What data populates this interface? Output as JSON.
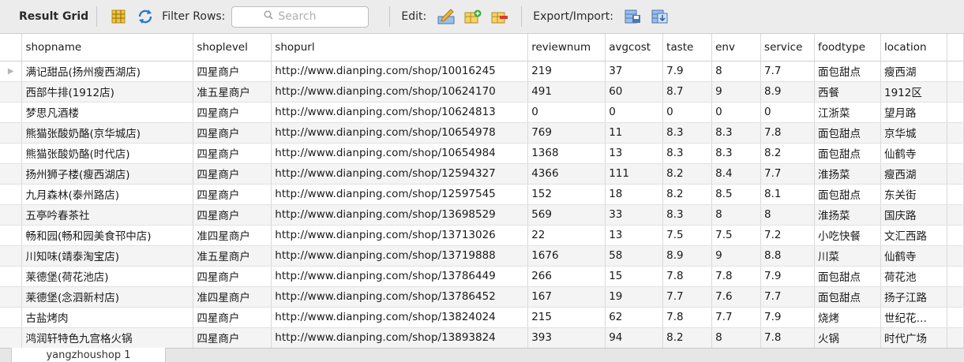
{
  "toolbar": {
    "result_grid_label": "Result Grid",
    "filter_rows_label": "Filter Rows:",
    "search_placeholder": "Search",
    "edit_label": "Edit:",
    "export_import_label": "Export/Import:"
  },
  "columns": [
    "shopname",
    "shoplevel",
    "shopurl",
    "reviewnum",
    "avgcost",
    "taste",
    "env",
    "service",
    "foodtype",
    "location"
  ],
  "rows": [
    [
      "满记甜品(扬州瘦西湖店)",
      "四星商户",
      "http://www.dianping.com/shop/10016245",
      "219",
      "37",
      "7.9",
      "8",
      "7.7",
      "面包甜点",
      "瘦西湖"
    ],
    [
      "西部牛排(1912店)",
      "准五星商户",
      "http://www.dianping.com/shop/10624170",
      "491",
      "60",
      "8.7",
      "9",
      "8.9",
      "西餐",
      "1912区"
    ],
    [
      "梦思凡酒楼",
      "四星商户",
      "http://www.dianping.com/shop/10624813",
      "0",
      "0",
      "0",
      "0",
      "0",
      "江浙菜",
      "望月路"
    ],
    [
      "熊猫张酸奶酪(京华城店)",
      "四星商户",
      "http://www.dianping.com/shop/10654978",
      "769",
      "11",
      "8.3",
      "8.3",
      "7.8",
      "面包甜点",
      "京华城"
    ],
    [
      "熊猫张酸奶酪(时代店)",
      "四星商户",
      "http://www.dianping.com/shop/10654984",
      "1368",
      "13",
      "8.3",
      "8.3",
      "8.2",
      "面包甜点",
      "仙鹤寺"
    ],
    [
      "扬州狮子楼(瘦西湖店)",
      "四星商户",
      "http://www.dianping.com/shop/12594327",
      "4366",
      "111",
      "8.2",
      "8.4",
      "7.7",
      "淮扬菜",
      "瘦西湖"
    ],
    [
      "九月森林(泰州路店)",
      "四星商户",
      "http://www.dianping.com/shop/12597545",
      "152",
      "18",
      "8.2",
      "8.5",
      "8.1",
      "面包甜点",
      "东关街"
    ],
    [
      "五亭吟春茶社",
      "四星商户",
      "http://www.dianping.com/shop/13698529",
      "569",
      "33",
      "8.3",
      "8",
      "8",
      "淮扬菜",
      "国庆路"
    ],
    [
      "畅和园(畅和园美食邗中店)",
      "准四星商户",
      "http://www.dianping.com/shop/13713026",
      "22",
      "13",
      "7.5",
      "7.5",
      "7.2",
      "小吃快餐",
      "文汇西路"
    ],
    [
      "川知味(靖泰淘宝店)",
      "准五星商户",
      "http://www.dianping.com/shop/13719888",
      "1676",
      "58",
      "8.9",
      "9",
      "8.8",
      "川菜",
      "仙鹤寺"
    ],
    [
      "莱德堡(荷花池店)",
      "四星商户",
      "http://www.dianping.com/shop/13786449",
      "266",
      "15",
      "7.8",
      "7.8",
      "7.9",
      "面包甜点",
      "荷花池"
    ],
    [
      "莱德堡(念泗新村店)",
      "准四星商户",
      "http://www.dianping.com/shop/13786452",
      "167",
      "19",
      "7.7",
      "7.6",
      "7.7",
      "面包甜点",
      "扬子江路"
    ],
    [
      "古盐烤肉",
      "四星商户",
      "http://www.dianping.com/shop/13824024",
      "215",
      "62",
      "7.8",
      "7.7",
      "7.9",
      "烧烤",
      "世纪花…"
    ],
    [
      "鸿润轩特色九宫格火锅",
      "四星商户",
      "http://www.dianping.com/shop/13893824",
      "393",
      "94",
      "8.2",
      "8",
      "7.8",
      "火锅",
      "时代广场"
    ]
  ],
  "bottom_tab_label": "yangzhoushop 1"
}
